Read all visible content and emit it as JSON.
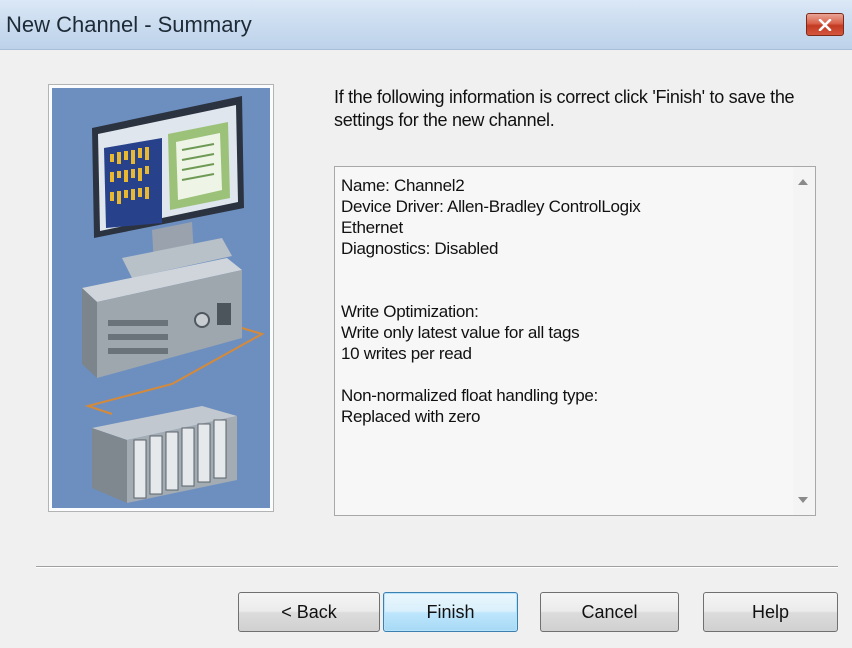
{
  "window": {
    "title": "New Channel - Summary",
    "close_icon": "close-icon"
  },
  "intro_text": "If the following information is correct click 'Finish' to save the settings for the new channel.",
  "summary": {
    "lines": [
      "Name: Channel2",
      "Device Driver: Allen-Bradley ControlLogix",
      "Ethernet",
      "Diagnostics: Disabled",
      "",
      "",
      "Write Optimization:",
      "Write only latest value for all tags",
      "10 writes per read",
      "",
      "Non-normalized float handling type:",
      "Replaced with zero"
    ]
  },
  "buttons": {
    "back": "< Back",
    "finish": "Finish",
    "cancel": "Cancel",
    "help": "Help"
  },
  "colors": {
    "title_bar": "#c9dbef",
    "close_button": "#c9452c",
    "default_button_border": "#3c7fb1",
    "illustration_background": "#6d8fc0"
  }
}
